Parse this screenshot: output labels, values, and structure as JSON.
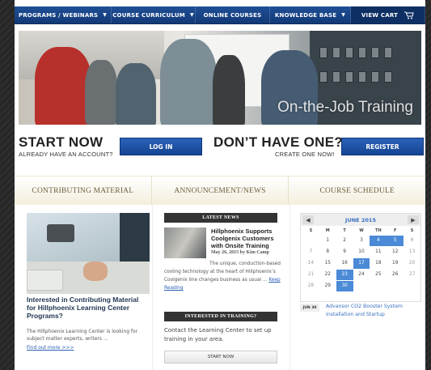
{
  "nav": {
    "items": [
      {
        "label": "PROGRAMS / WEBINARS",
        "caret": "▼"
      },
      {
        "label": "COURSE CURRICULUM",
        "caret": "▼"
      },
      {
        "label": "ONLINE COURSES",
        "caret": ""
      },
      {
        "label": "KNOWLEDGE BASE",
        "caret": "▼"
      },
      {
        "label": "VIEW CART",
        "caret": ""
      }
    ]
  },
  "hero": {
    "caption": "On-the-Job Training"
  },
  "login": {
    "start_now": "START NOW",
    "already": "ALREADY HAVE AN ACCOUNT?",
    "login_button": "LOG IN",
    "dont_have": "DON’T HAVE ONE?",
    "create": "CREATE ONE NOW!",
    "register_button": "REGISTER"
  },
  "columns": {
    "contributing": "CONTRIBUTING MATERIAL",
    "announcement": "ANNOUNCEMENT/NEWS",
    "schedule": "COURSE SCHEDULE"
  },
  "contributing": {
    "title": "Interested in Contributing Material for Hillphoenix Learning Center Programs?",
    "text": "The Hillphoenix Learning Center is looking for subject matter experts, writers ...",
    "link": "Find out more >>>"
  },
  "news": {
    "bar": "LATEST NEWS",
    "title": "Hillphoenix Supports Coolgenix Customers with Onsite Training",
    "date": "May 26, 2015 by Kim Camp",
    "lead": "The unique, conduction-based",
    "body": "cooling technology at the heart of Hillphoenix’s Coolgenix line changes business as usual ...",
    "keep": "Keep Reading",
    "training_bar": "INTERESTED IN TRAINING?",
    "contact": "Contact the Learning Center to set up training in your area.",
    "start_button": "START NOW"
  },
  "calendar": {
    "month": "JUNE 2015",
    "prev": "◀",
    "next": "▶",
    "dow": [
      "S",
      "M",
      "T",
      "W",
      "TH",
      "F",
      "S"
    ],
    "weeks": [
      [
        "",
        "1",
        "2",
        "3",
        "4",
        "5",
        "6"
      ],
      [
        "7",
        "8",
        "9",
        "10",
        "11",
        "12",
        "13"
      ],
      [
        "14",
        "15",
        "16",
        "17",
        "18",
        "19",
        "20"
      ],
      [
        "21",
        "22",
        "23",
        "24",
        "25",
        "26",
        "27"
      ],
      [
        "28",
        "29",
        "30",
        "",
        "",
        "",
        ""
      ]
    ],
    "highlighted": [
      "4",
      "5",
      "17",
      "23",
      "30"
    ],
    "event_date": "JUN 30",
    "event_title": "Advansor CO2 Booster System Installation and Startup"
  }
}
